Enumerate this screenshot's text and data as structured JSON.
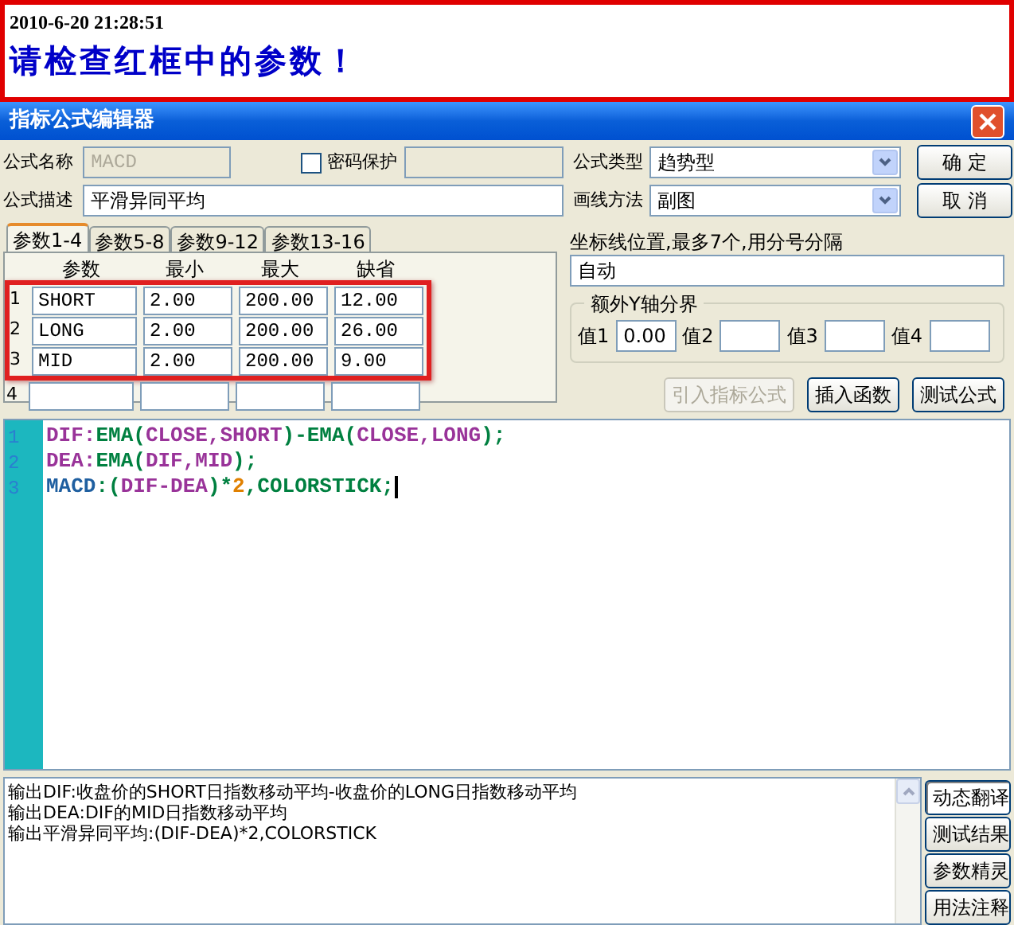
{
  "notice": {
    "timestamp": "2010-6-20 21:28:51",
    "message": "请检查红框中的参数！"
  },
  "window": {
    "title": "指标公式编辑器"
  },
  "form": {
    "name_label": "公式名称",
    "name_value": "MACD",
    "password_checkbox": {
      "label": "密码保护",
      "checked": false
    },
    "description_label": "公式描述",
    "description_value": "平滑异同平均",
    "type_label": "公式类型",
    "type_value": "趋势型",
    "draw_label": "画线方法",
    "draw_value": "副图"
  },
  "dialog_buttons": [
    "确  定",
    "取  消"
  ],
  "tabs": [
    {
      "label": "参数1-4",
      "selected": true
    },
    {
      "label": "参数5-8",
      "selected": false
    },
    {
      "label": "参数9-12",
      "selected": false
    },
    {
      "label": "参数13-16",
      "selected": false
    }
  ],
  "params": {
    "columns": [
      "参数",
      "最小",
      "最大",
      "缺省"
    ],
    "rows": [
      {
        "number": "1",
        "cells": [
          "SHORT",
          "2.00",
          "200.00",
          "12.00"
        ],
        "highlighted": true
      },
      {
        "number": "2",
        "cells": [
          "LONG",
          "2.00",
          "200.00",
          "26.00"
        ],
        "highlighted": true
      },
      {
        "number": "3",
        "cells": [
          "MID",
          "2.00",
          "200.00",
          "9.00"
        ],
        "highlighted": true
      },
      {
        "number": "4",
        "highlighted": false
      }
    ]
  },
  "axis": {
    "label": "坐标线位置,最多7个,用分号分隔",
    "value": "自动"
  },
  "y_bounds": {
    "title": "额外Y轴分界",
    "fields": [
      {
        "label": "值1",
        "value": "0.00"
      },
      {
        "label": "值2"
      },
      {
        "label": "值3"
      },
      {
        "label": "值4"
      }
    ]
  },
  "tool_buttons": [
    {
      "label": "引入指标公式",
      "disabled": true
    },
    {
      "label": "插入函数",
      "disabled": false
    },
    {
      "label": "测试公式",
      "disabled": false
    }
  ],
  "editor": {
    "lines": [
      {
        "number": "1",
        "tokens": [
          {
            "text": "DIF:",
            "kind": "variable"
          },
          {
            "text": "EMA(",
            "kind": "function"
          },
          {
            "text": "CLOSE,SHORT",
            "kind": "variable"
          },
          {
            "text": ")-EMA(",
            "kind": "function"
          },
          {
            "text": "CLOSE,LONG",
            "kind": "variable"
          },
          {
            "text": ");",
            "kind": "function"
          }
        ]
      },
      {
        "number": "2",
        "tokens": [
          {
            "text": "DEA:",
            "kind": "variable"
          },
          {
            "text": "EMA(",
            "kind": "function"
          },
          {
            "text": "DIF,MID",
            "kind": "variable"
          },
          {
            "text": ");",
            "kind": "function"
          }
        ]
      },
      {
        "number": "3",
        "tokens": [
          {
            "text": "MACD",
            "kind": "output"
          },
          {
            "text": ":(",
            "kind": "function"
          },
          {
            "text": "DIF-DEA",
            "kind": "variable"
          },
          {
            "text": ")*",
            "kind": "function"
          },
          {
            "text": "2",
            "kind": "number"
          },
          {
            "text": ",COLORSTICK;",
            "kind": "function"
          }
        ],
        "cursor": true
      }
    ]
  },
  "output": {
    "lines": [
      "输出DIF:收盘价的SHORT日指数移动平均-收盘价的LONG日指数移动平均",
      "输出DEA:DIF的MID日指数移动平均",
      "输出平滑异同平均:(DIF-DEA)*2,COLORSTICK"
    ]
  },
  "side_buttons": [
    {
      "label": "动态翻译",
      "selected": true
    },
    {
      "label": "测试结果",
      "selected": false
    },
    {
      "label": "参数精灵",
      "selected": false
    },
    {
      "label": "用法注释",
      "selected": false
    }
  ]
}
